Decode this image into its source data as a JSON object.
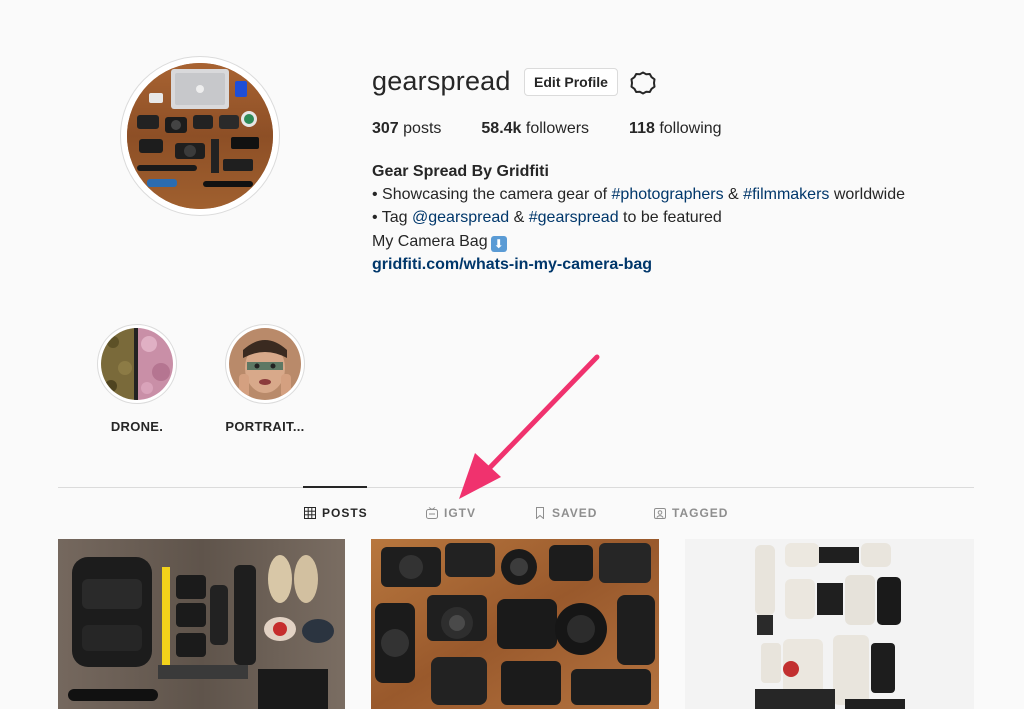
{
  "profile": {
    "username": "gearspread",
    "edit_button": "Edit Profile",
    "settings_icon": "gear-icon",
    "stats": {
      "posts_count": "307",
      "posts_label": "posts",
      "followers_count": "58.4k",
      "followers_label": "followers",
      "following_count": "118",
      "following_label": "following"
    },
    "bio": {
      "name": "Gear Spread By Gridfiti",
      "line1_pre": "• Showcasing the camera gear of ",
      "line1_tag1": "#photographers",
      "line1_mid": " & ",
      "line1_tag2": "#filmmakers",
      "line1_post": " worldwide",
      "line2_pre": "• Tag ",
      "line2_tag1": "@gearspread",
      "line2_mid": " & ",
      "line2_tag2": "#gearspread",
      "line2_post": " to be featured",
      "line3": "My Camera Bag",
      "line3_emoji": "⬇",
      "link": "gridfiti.com/whats-in-my-camera-bag"
    }
  },
  "highlights": [
    {
      "label": "DRONE."
    },
    {
      "label": "PORTRAIT..."
    }
  ],
  "tabs": [
    {
      "label": "POSTS",
      "icon": "grid-icon",
      "active": true
    },
    {
      "label": "IGTV",
      "icon": "igtv-icon",
      "active": false
    },
    {
      "label": "SAVED",
      "icon": "bookmark-icon",
      "active": false
    },
    {
      "label": "TAGGED",
      "icon": "tagged-icon",
      "active": false
    }
  ],
  "colors": {
    "link": "#00376b",
    "annotation_arrow": "#f0326e",
    "text": "#262626",
    "muted": "#8e8e8e"
  }
}
